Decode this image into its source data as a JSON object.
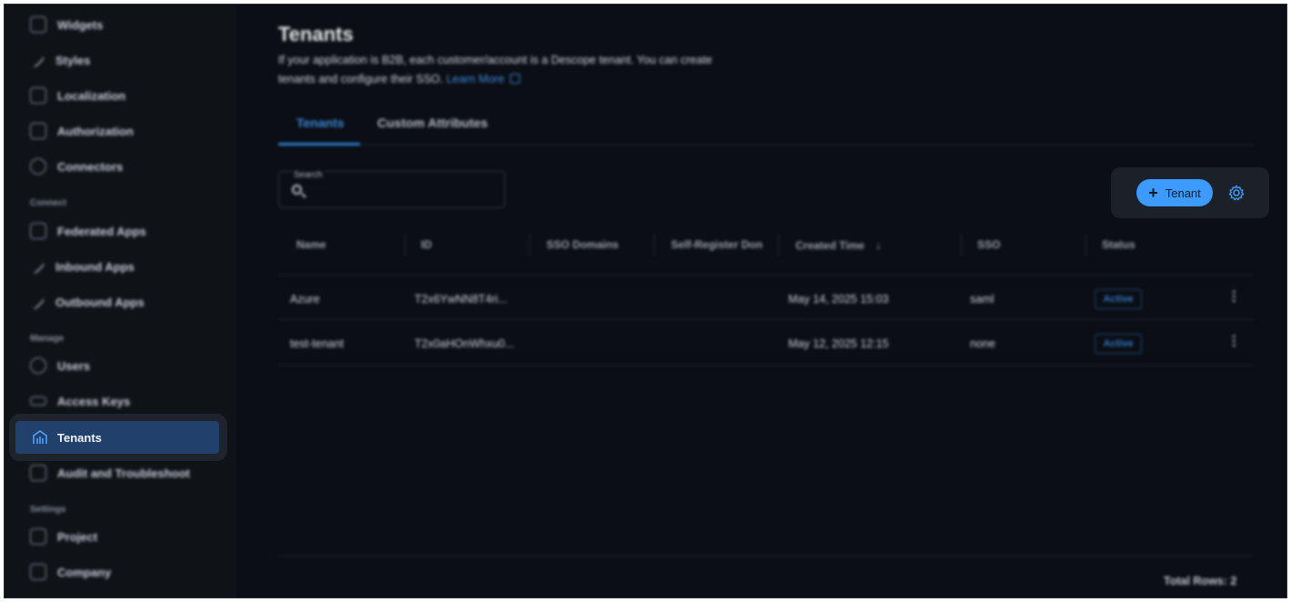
{
  "sidebar": {
    "items_top": [
      {
        "label": "Widgets",
        "icon": "widgets-icon"
      },
      {
        "label": "Styles",
        "icon": "brush-icon"
      },
      {
        "label": "Localization",
        "icon": "translate-icon"
      },
      {
        "label": "Authorization",
        "icon": "lock-icon"
      },
      {
        "label": "Connectors",
        "icon": "connectors-icon"
      }
    ],
    "section_connect": "Connect",
    "items_connect": [
      {
        "label": "Federated Apps",
        "icon": "grid-icon"
      },
      {
        "label": "Inbound Apps",
        "icon": "inbound-icon"
      },
      {
        "label": "Outbound Apps",
        "icon": "outbound-icon"
      }
    ],
    "section_manage": "Manage",
    "items_manage": [
      {
        "label": "Users",
        "icon": "users-icon"
      },
      {
        "label": "Access Keys",
        "icon": "key-icon"
      },
      {
        "label": "Tenants",
        "icon": "tenants-icon",
        "active": true
      },
      {
        "label": "Audit and Troubleshoot",
        "icon": "audit-icon"
      }
    ],
    "section_settings": "Settings",
    "items_settings": [
      {
        "label": "Project",
        "icon": "folder-icon"
      },
      {
        "label": "Company",
        "icon": "company-icon"
      }
    ]
  },
  "page": {
    "title": "Tenants",
    "description_1": "If your application is B2B, each customer/account is a Descope tenant. You can create",
    "description_2": "tenants and configure their SSO.",
    "learn_more": "Learn More"
  },
  "tabs": [
    {
      "label": "Tenants",
      "active": true
    },
    {
      "label": "Custom Attributes",
      "active": false
    }
  ],
  "search": {
    "label": "Search",
    "placeholder": ""
  },
  "actions": {
    "add_label": "Tenant"
  },
  "table": {
    "columns": [
      "Name",
      "ID",
      "SSO Domains",
      "Self-Register Don",
      "Created Time",
      "SSO",
      "Status"
    ],
    "rows": [
      {
        "name": "Azure",
        "id": "T2x6YwNN8T4ri...",
        "sso_domains": "",
        "self_register": "",
        "created": "May 14, 2025 15:03",
        "sso": "saml",
        "status": "Active"
      },
      {
        "name": "test-tenant",
        "id": "T2x0aHOnWhxu0...",
        "sso_domains": "",
        "self_register": "",
        "created": "May 12, 2025 12:15",
        "sso": "none",
        "status": "Active"
      }
    ],
    "total_rows": "Total Rows: 2"
  },
  "colors": {
    "accent": "#3d9bff",
    "active_nav": "#21406b",
    "background": "#0b0e14"
  }
}
